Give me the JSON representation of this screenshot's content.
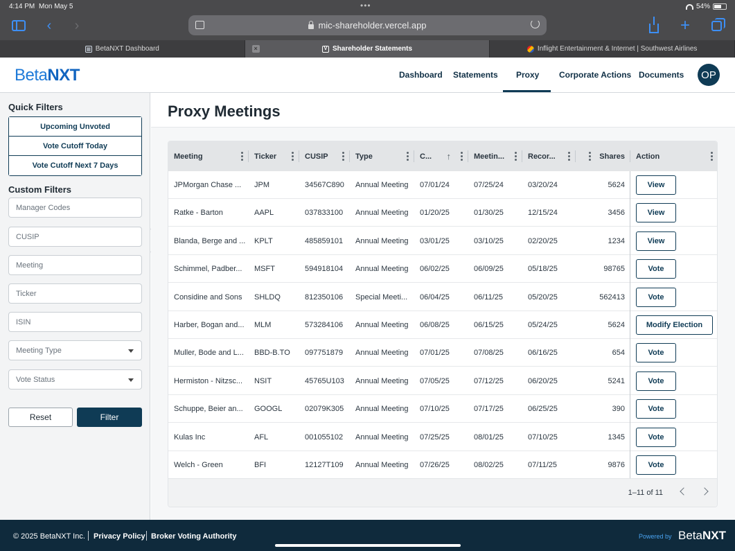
{
  "status": {
    "time": "4:14 PM",
    "date": "Mon May 5",
    "battery": "54%"
  },
  "browser": {
    "url": "mic-shareholder.vercel.app",
    "tabs": [
      {
        "label": "BetaNXT Dashboard",
        "active": false
      },
      {
        "label": "Shareholder Statements",
        "active": true
      },
      {
        "label": "Inflight Entertainment & Internet | Southwest Airlines",
        "active": false
      }
    ]
  },
  "header": {
    "logo_part1": "Beta",
    "logo_part2": "NXT",
    "nav": [
      "Dashboard",
      "Statements",
      "Proxy",
      "Corporate Actions",
      "Documents"
    ],
    "active_nav": "Proxy",
    "avatar_initials": "OP"
  },
  "sidebar": {
    "quick_filters_title": "Quick Filters",
    "quick_filters": [
      "Upcoming Unvoted",
      "Vote Cutoff Today",
      "Vote Cutoff Next 7 Days"
    ],
    "custom_filters_title": "Custom Filters",
    "inputs": [
      "Manager Codes",
      "CUSIP",
      "Meeting",
      "Ticker",
      "ISIN"
    ],
    "selects": [
      "Meeting Type",
      "Vote Status"
    ],
    "reset_label": "Reset",
    "filter_label": "Filter"
  },
  "main": {
    "title": "Proxy Meetings",
    "columns": [
      "Meeting",
      "Ticker",
      "CUSIP",
      "Type",
      "C...",
      "Meetin...",
      "Recor...",
      "",
      "Shares",
      "Action"
    ],
    "rows": [
      {
        "meeting": "JPMorgan Chase ...",
        "ticker": "JPM",
        "cusip": "34567C890",
        "type": "Annual Meeting",
        "cutoff": "07/01/24",
        "meeting_date": "07/25/24",
        "record_date": "03/20/24",
        "shares": "5624",
        "action": "View"
      },
      {
        "meeting": "Ratke - Barton",
        "ticker": "AAPL",
        "cusip": "037833100",
        "type": "Annual Meeting",
        "cutoff": "01/20/25",
        "meeting_date": "01/30/25",
        "record_date": "12/15/24",
        "shares": "3456",
        "action": "View"
      },
      {
        "meeting": "Blanda, Berge and ...",
        "ticker": "KPLT",
        "cusip": "485859101",
        "type": "Annual Meeting",
        "cutoff": "03/01/25",
        "meeting_date": "03/10/25",
        "record_date": "02/20/25",
        "shares": "1234",
        "action": "View"
      },
      {
        "meeting": "Schimmel, Padber...",
        "ticker": "MSFT",
        "cusip": "594918104",
        "type": "Annual Meeting",
        "cutoff": "06/02/25",
        "meeting_date": "06/09/25",
        "record_date": "05/18/25",
        "shares": "98765",
        "action": "Vote"
      },
      {
        "meeting": "Considine and Sons",
        "ticker": "SHLDQ",
        "cusip": "812350106",
        "type": "Special Meeti...",
        "cutoff": "06/04/25",
        "meeting_date": "06/11/25",
        "record_date": "05/20/25",
        "shares": "562413",
        "action": "Vote"
      },
      {
        "meeting": "Harber, Bogan and...",
        "ticker": "MLM",
        "cusip": "573284106",
        "type": "Annual Meeting",
        "cutoff": "06/08/25",
        "meeting_date": "06/15/25",
        "record_date": "05/24/25",
        "shares": "5624",
        "action": "Modify Election"
      },
      {
        "meeting": "Muller, Bode and L...",
        "ticker": "BBD-B.TO",
        "cusip": "097751879",
        "type": "Annual Meeting",
        "cutoff": "07/01/25",
        "meeting_date": "07/08/25",
        "record_date": "06/16/25",
        "shares": "654",
        "action": "Vote"
      },
      {
        "meeting": "Hermiston - Nitzsc...",
        "ticker": "NSIT",
        "cusip": "45765U103",
        "type": "Annual Meeting",
        "cutoff": "07/05/25",
        "meeting_date": "07/12/25",
        "record_date": "06/20/25",
        "shares": "5241",
        "action": "Vote"
      },
      {
        "meeting": "Schuppe, Beier an...",
        "ticker": "GOOGL",
        "cusip": "02079K305",
        "type": "Annual Meeting",
        "cutoff": "07/10/25",
        "meeting_date": "07/17/25",
        "record_date": "06/25/25",
        "shares": "390",
        "action": "Vote"
      },
      {
        "meeting": "Kulas Inc",
        "ticker": "AFL",
        "cusip": "001055102",
        "type": "Annual Meeting",
        "cutoff": "07/25/25",
        "meeting_date": "08/01/25",
        "record_date": "07/10/25",
        "shares": "1345",
        "action": "Vote"
      },
      {
        "meeting": "Welch - Green",
        "ticker": "BFI",
        "cusip": "12127T109",
        "type": "Annual Meeting",
        "cutoff": "07/26/25",
        "meeting_date": "08/02/25",
        "record_date": "07/11/25",
        "shares": "9876",
        "action": "Vote"
      }
    ],
    "pagination": "1–11 of 11"
  },
  "footer": {
    "copyright": "© 2025 BetaNXT Inc.",
    "links": [
      "Privacy Policy",
      "Broker Voting Authority"
    ],
    "powered_by": "Powered by",
    "logo_part1": "Beta",
    "logo_part2": "NXT"
  }
}
